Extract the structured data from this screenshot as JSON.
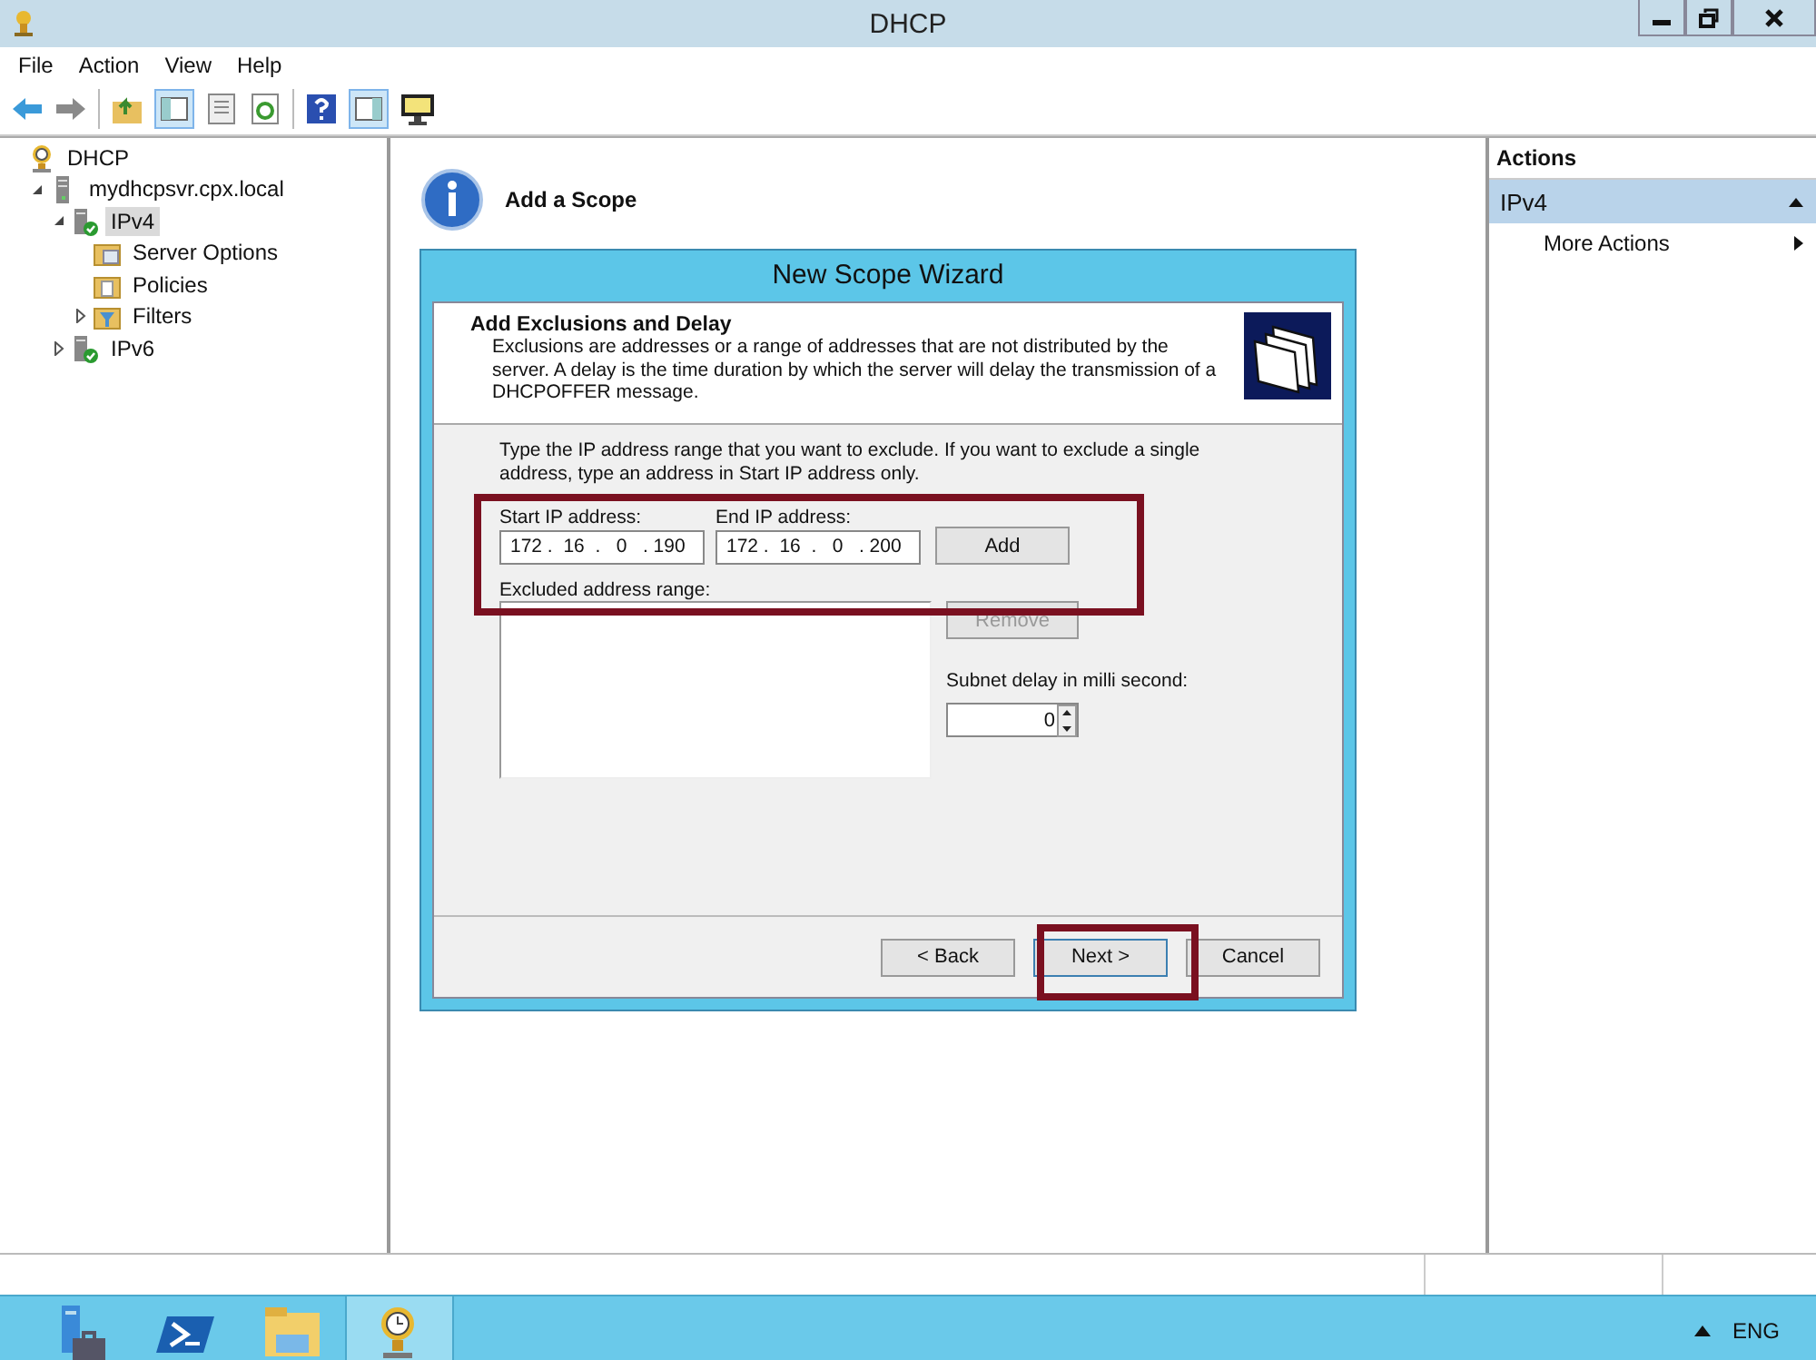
{
  "window": {
    "title": "DHCP"
  },
  "menu": [
    "File",
    "Action",
    "View",
    "Help"
  ],
  "tree": [
    {
      "label": "DHCP",
      "kind": "dhcp",
      "selected": false,
      "children": [
        {
          "label": "mydhcpsvr.cpx.local",
          "kind": "server",
          "expanded": true,
          "selected": false,
          "children": [
            {
              "label": "IPv4",
              "kind": "protocol",
              "expanded": true,
              "selected": true,
              "children": [
                {
                  "label": "Server Options",
                  "kind": "options",
                  "selected": false
                },
                {
                  "label": "Policies",
                  "kind": "policies",
                  "selected": false
                },
                {
                  "label": "Filters",
                  "kind": "filters",
                  "expanded": false,
                  "selected": false
                }
              ]
            },
            {
              "label": "IPv6",
              "kind": "protocol",
              "expanded": false,
              "selected": false
            }
          ]
        }
      ]
    }
  ],
  "center": {
    "heading": "Add a Scope"
  },
  "wizard": {
    "title": "New Scope Wizard",
    "page_title": "Add Exclusions and Delay",
    "page_description": "Exclusions are addresses or a range of addresses that are not distributed by the server. A delay is the time duration by which the server will delay the transmission of a DHCPOFFER message.",
    "instruction": "Type the IP address range that you want to exclude. If you want to exclude a single address, type an address in Start IP address only.",
    "start_ip": {
      "label": "Start IP address:",
      "value": "172 .  16  .   0   . 190"
    },
    "end_ip": {
      "label": "End IP address:",
      "value": "172 .  16  .   0   . 200"
    },
    "add_button": {
      "label": "Add",
      "disabled": false
    },
    "excluded_label": "Excluded address range:",
    "remove_button": {
      "label": "Remove",
      "disabled": true
    },
    "delay": {
      "label": "Subnet delay in milli second:",
      "value": "0"
    },
    "buttons": [
      {
        "label": "< Back",
        "focused": false
      },
      {
        "label": "Next >",
        "focused": true
      },
      {
        "label": "Cancel",
        "focused": false
      }
    ]
  },
  "actions": {
    "title": "Actions",
    "groups": [
      {
        "label": "IPv4",
        "expanded": true,
        "items": [
          "More Actions"
        ]
      }
    ]
  },
  "taskbar": {
    "items": [
      {
        "kind": "server-manager",
        "selected": false
      },
      {
        "kind": "powershell",
        "selected": false
      },
      {
        "kind": "explorer",
        "selected": false
      },
      {
        "kind": "dhcp",
        "selected": true
      }
    ],
    "language": "ENG"
  }
}
